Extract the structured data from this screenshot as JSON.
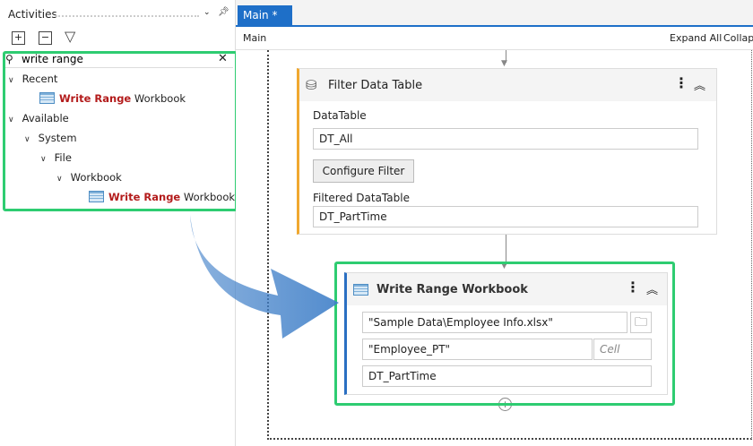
{
  "activities": {
    "title": "Activities",
    "search_value": "write range",
    "tree": {
      "recent": "Recent",
      "available": "Available",
      "system": "System",
      "file": "File",
      "workbook": "Workbook",
      "item_highlight": "Write Range",
      "item_rest": " Workbook"
    }
  },
  "tab": {
    "label": "Main *"
  },
  "toolbar": {
    "breadcrumb": "Main",
    "expand_all": "Expand All",
    "collapse_all": "Collapse All"
  },
  "filter_card": {
    "title": "Filter Data Table",
    "datatable_label": "DataTable",
    "datatable_value": "DT_All",
    "configure_button": "Configure Filter",
    "filtered_label": "Filtered DataTable",
    "filtered_value": "DT_PartTime"
  },
  "write_card": {
    "title": "Write Range Workbook",
    "path_value": "\"Sample Data\\Employee Info.xlsx\"",
    "sheet_value": "\"Employee_PT\"",
    "cell_placeholder": "Cell",
    "datatable_value": "DT_PartTime"
  },
  "colors": {
    "highlight": "#2ecc71",
    "tab": "#1e6fc8",
    "filter_accent": "#f0a830",
    "write_accent": "#2a6fc2"
  }
}
